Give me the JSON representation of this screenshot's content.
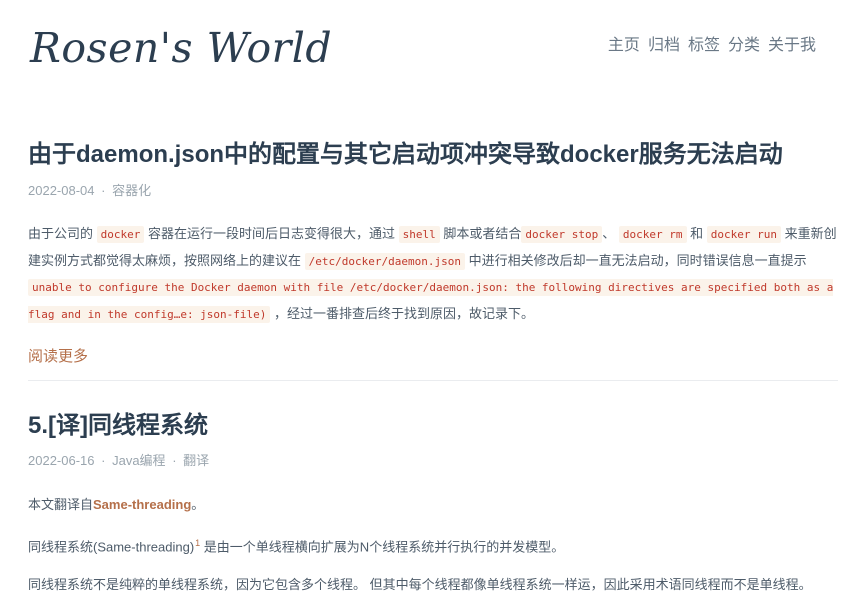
{
  "site": {
    "title": "Rosen's World",
    "nav": [
      "主页",
      "归档",
      "标签",
      "分类",
      "关于我"
    ]
  },
  "posts": [
    {
      "title": "由于daemon.json中的配置与其它启动项冲突导致docker服务无法启动",
      "date": "2022-08-04",
      "separator": "·",
      "category": "容器化",
      "excerpt": {
        "t1": "由于公司的",
        "c1": "docker",
        "t2": "容器在运行一段时间后日志变得很大，通过",
        "c2": "shell",
        "t3": "脚本或者结合",
        "c3": "docker stop",
        "t4": "、",
        "c4": "docker rm",
        "t5": "和",
        "c5": "docker run",
        "t6": "来重新创建实例方式都觉得太麻烦，按照网络上的建议在",
        "c6": "/etc/docker/daemon.json",
        "t7": "中进行相关修改后却一直无法启动，同时错误信息一直提示",
        "c7": "unable to configure the Docker daemon with file /etc/docker/daemon.json: the following directives are specified both as a flag and in the config…e: json-file)",
        "t8": "，经过一番排查后终于找到原因，故记录下。"
      },
      "read_more": "阅读更多"
    },
    {
      "title": "5.[译]同线程系统",
      "date": "2022-06-16",
      "separator": "·",
      "category": "Java编程",
      "separator2": "·",
      "category2": "翻译",
      "para1_prefix": "本文翻译自",
      "para1_link": "Same-threading",
      "para1_suffix": "。",
      "para2_text": "同线程系统(Same-threading)",
      "para2_sup": "1",
      "para2_rest": " 是由一个单线程横向扩展为N个线程系统并行执行的并发模型。",
      "para3": "同线程系统不是纯粹的单线程系统，因为它包含多个线程。 但其中每个线程都像单线程系统一样运，因此采用术语同线程而不是单线程。"
    }
  ]
}
